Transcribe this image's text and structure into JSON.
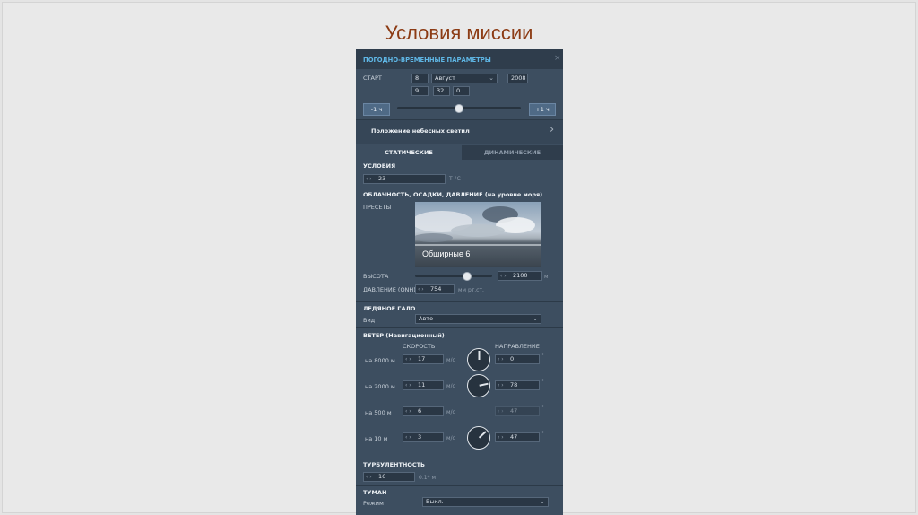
{
  "slide": {
    "title": "Условия миссии"
  },
  "panel": {
    "header": "ПОГОДНО-ВРЕМЕННЫЕ ПАРАМЕТРЫ",
    "close": "×",
    "start": {
      "label": "СТАРТ",
      "day": "8",
      "month": "Август",
      "year": "2008",
      "hour": "9",
      "minute": "32",
      "second": "0",
      "minus_hour": "-1 ч",
      "plus_hour": "+1 ч",
      "time_slider_fraction": 0.5
    },
    "celestial": {
      "label": "Положение небесных светил",
      "chevron": "›"
    },
    "tabs": {
      "static": "СТАТИЧЕСКИЕ",
      "dynamic": "ДИНАМИЧЕСКИЕ"
    },
    "conditions": {
      "title": "УСЛОВИЯ",
      "temperature": "23",
      "temperature_unit": "T °C"
    },
    "clouds": {
      "title": "ОБЛАЧНОСТЬ, ОСАДКИ, ДАВЛЕНИЕ (на уровне моря)",
      "presets_label": "ПРЕСЕТЫ",
      "preset_name": "Обширные 6",
      "height_label": "ВЫСОТА",
      "height_value": "2100",
      "height_unit": "м",
      "height_slider_fraction": 0.68,
      "pressure_label": "ДАВЛЕНИЕ (QNH)",
      "pressure_value": "754",
      "pressure_unit": "мм рт.ст."
    },
    "halo": {
      "title": "ЛЕДЯНОЕ ГАЛО",
      "view_label": "Вид",
      "view_value": "Авто"
    },
    "wind": {
      "title": "ВЕТЕР (Навигационный)",
      "speed_header": "СКОРОСТЬ",
      "direction_header": "НАПРАВЛЕНИЕ",
      "speed_unit": "м/с",
      "degree_unit": "°",
      "rows": [
        {
          "label": "на 8000 м",
          "speed": "17",
          "direction": "0",
          "dial": true
        },
        {
          "label": "на 2000 м",
          "speed": "11",
          "direction": "78",
          "dial": true
        },
        {
          "label": "на 500 м",
          "speed": "6",
          "direction": "47",
          "dial": false
        },
        {
          "label": "на 10 м",
          "speed": "3",
          "direction": "47",
          "dial": true
        }
      ]
    },
    "turbulence": {
      "title": "ТУРБУЛЕНТНОСТЬ",
      "value": "16",
      "unit": "0.1* м"
    },
    "fog": {
      "title": "ТУМАН",
      "mode_label": "Режим",
      "mode_value": "Выкл."
    },
    "spin_arrows": "‹ ›",
    "dropdown_chevron": "⌄"
  }
}
